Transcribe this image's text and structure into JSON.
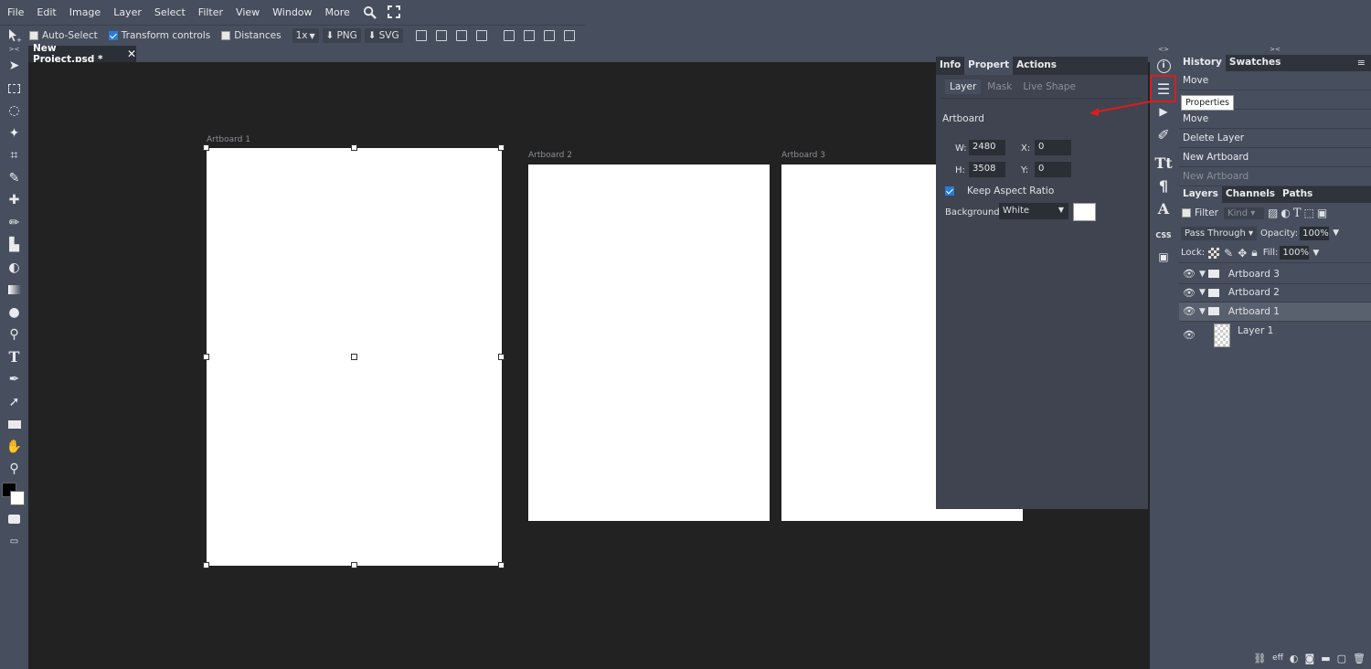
{
  "menu": {
    "items": [
      "File",
      "Edit",
      "Image",
      "Layer",
      "Select",
      "Filter",
      "View",
      "Window",
      "More"
    ],
    "icons": [
      "search-icon",
      "fullscreen-icon"
    ]
  },
  "options": {
    "auto_select": {
      "label": "Auto-Select",
      "checked": false
    },
    "transform_controls": {
      "label": "Transform controls",
      "checked": true
    },
    "distances": {
      "label": "Distances",
      "checked": false
    },
    "scale": "1x",
    "export_png": "PNG",
    "export_svg": "SVG"
  },
  "document": {
    "tab_title": "New Project.psd *",
    "close": "✕"
  },
  "artboards": [
    {
      "label": "Artboard 1"
    },
    {
      "label": "Artboard 2"
    },
    {
      "label": "Artboard 3"
    }
  ],
  "properties_panel": {
    "tabs": [
      "Info",
      "Propert",
      "Actions"
    ],
    "active_tab": "Propert",
    "subtabs": [
      "Layer",
      "Mask",
      "Live Shape"
    ],
    "section_title": "Artboard",
    "w_label": "W:",
    "w_value": "2480",
    "x_label": "X:",
    "x_value": "0",
    "h_label": "H:",
    "h_value": "3508",
    "y_label": "Y:",
    "y_value": "0",
    "keep_aspect": {
      "label": "Keep Aspect Ratio",
      "checked": true
    },
    "background_label": "Background:",
    "background_value": "White",
    "background_color": "#ffffff"
  },
  "tooltip": "Properties",
  "history_panel": {
    "tabs": [
      "History",
      "Swatches"
    ],
    "items": [
      {
        "label": "Move",
        "dim": false
      },
      {
        "label": "",
        "dim": false
      },
      {
        "label": "Move",
        "dim": false
      },
      {
        "label": "Delete Layer",
        "dim": false
      },
      {
        "label": "New Artboard",
        "dim": false
      },
      {
        "label": "New Artboard",
        "dim": true
      }
    ]
  },
  "layers_panel": {
    "tabs": [
      "Layers",
      "Channels",
      "Paths"
    ],
    "filter_label": "Filter",
    "kind_label": "Kind",
    "blend_mode": "Pass Through",
    "opacity_label": "Opacity:",
    "opacity_value": "100%",
    "lock_label": "Lock:",
    "fill_label": "Fill:",
    "fill_value": "100%",
    "layers": [
      {
        "name": "Artboard 3",
        "type": "group",
        "selected": false
      },
      {
        "name": "Artboard 2",
        "type": "group",
        "selected": false
      },
      {
        "name": "Artboard 1",
        "type": "group",
        "selected": true
      },
      {
        "name": "Layer 1",
        "type": "layer",
        "selected": false
      }
    ],
    "footer_eff": "eff"
  },
  "colors": {
    "canvas_bg": "#222222",
    "ui_bg": "#474e5d",
    "accent": "#2b7cd3",
    "highlight": "#e01b1b"
  }
}
